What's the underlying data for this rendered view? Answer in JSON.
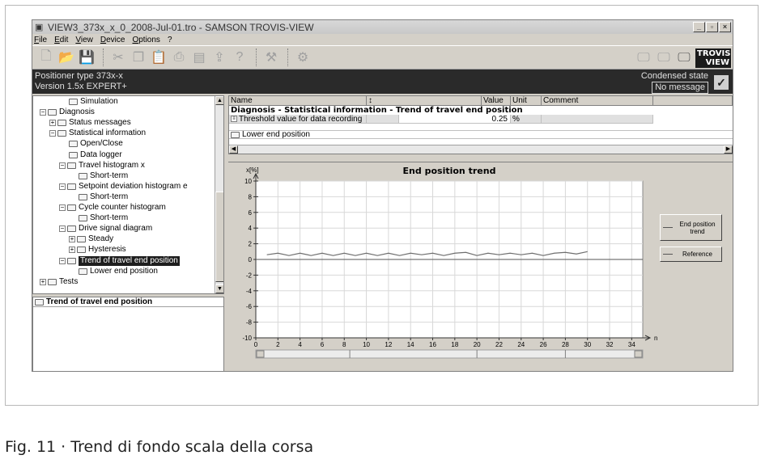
{
  "window": {
    "title": "VIEW3_373x_x_0_2008-Jul-01.tro - SAMSON TROVIS-VIEW",
    "controls": [
      "_",
      "▫",
      "×"
    ]
  },
  "menu": [
    "File",
    "Edit",
    "View",
    "Device",
    "Options",
    "?"
  ],
  "toolbar": {
    "left_icons": [
      "new-icon",
      "open-icon",
      "save-icon",
      "cut-icon",
      "copy-icon",
      "paste-icon",
      "print-icon",
      "edit-icon",
      "upload-icon",
      "help-icon",
      "tools-icon",
      "device-icon"
    ],
    "right_icons": [
      "monitor-offline-icon",
      "monitor-icon",
      "monitor-online-icon"
    ],
    "logo_line1": "TROVIS",
    "logo_line2": "VIEW"
  },
  "infobar": {
    "device_line1": "Positioner type 373x-x",
    "device_line2": "Version 1.5x EXPERT+",
    "condensed_label": "Condensed state",
    "condensed_value": "No message"
  },
  "tree": {
    "items": [
      {
        "label": "Simulation",
        "indent": 3,
        "expander": ""
      },
      {
        "label": "Diagnosis",
        "indent": 1,
        "expander": "−"
      },
      {
        "label": "Status messages",
        "indent": 2,
        "expander": "+"
      },
      {
        "label": "Statistical information",
        "indent": 2,
        "expander": "−"
      },
      {
        "label": "Open/Close",
        "indent": 3,
        "expander": ""
      },
      {
        "label": "Data logger",
        "indent": 3,
        "expander": ""
      },
      {
        "label": "Travel histogram x",
        "indent": 3,
        "expander": "−"
      },
      {
        "label": "Short-term",
        "indent": 4,
        "expander": ""
      },
      {
        "label": "Setpoint deviation histogram e",
        "indent": 3,
        "expander": "−"
      },
      {
        "label": "Short-term",
        "indent": 4,
        "expander": ""
      },
      {
        "label": "Cycle counter histogram",
        "indent": 3,
        "expander": "−"
      },
      {
        "label": "Short-term",
        "indent": 4,
        "expander": ""
      },
      {
        "label": "Drive signal diagram",
        "indent": 3,
        "expander": "−"
      },
      {
        "label": "Steady",
        "indent": 4,
        "expander": "+"
      },
      {
        "label": "Hysteresis",
        "indent": 4,
        "expander": "+"
      },
      {
        "label": "Trend of travel end position",
        "indent": 3,
        "expander": "−",
        "selected": true
      },
      {
        "label": "Lower end position",
        "indent": 4,
        "expander": ""
      },
      {
        "label": "Tests",
        "indent": 1,
        "expander": "+"
      }
    ]
  },
  "detail": {
    "title": "Trend of travel end position"
  },
  "grid": {
    "headers": [
      "Name",
      "↕",
      "Value",
      "Unit",
      "Comment"
    ],
    "group_title": "Diagnosis - Statistical information - Trend of travel end position",
    "rows": [
      {
        "name": "Threshold value for data recording",
        "value": "0.25",
        "unit": "%",
        "comment": ""
      }
    ],
    "sub_item": "Lower end position"
  },
  "chart_data": {
    "type": "line",
    "title": "End position trend",
    "ylabel": "x[%]",
    "xlabel": "n",
    "xlim": [
      0,
      35
    ],
    "ylim": [
      -10,
      10
    ],
    "x_ticks": [
      0,
      2,
      4,
      6,
      8,
      10,
      12,
      14,
      16,
      18,
      20,
      22,
      24,
      26,
      28,
      30,
      32,
      34
    ],
    "x_tick_labels": [
      "0",
      "2",
      "4",
      "6",
      "8",
      "10",
      "12",
      "14",
      "16",
      "18",
      "20",
      "22",
      "24",
      "26",
      "28",
      "30",
      "32",
      "34"
    ],
    "y_ticks": [
      10,
      8,
      6,
      4,
      2,
      0,
      -2,
      -4,
      -6,
      -8,
      -10
    ],
    "grid": true,
    "legend_position": "right",
    "series": [
      {
        "name": "End position trend",
        "color": "#6e6e6e",
        "x": [
          1,
          2,
          3,
          4,
          5,
          6,
          7,
          8,
          9,
          10,
          11,
          12,
          13,
          14,
          15,
          16,
          17,
          18,
          19,
          20,
          21,
          22,
          23,
          24,
          25,
          26,
          27,
          28,
          29,
          30
        ],
        "y": [
          0.6,
          0.8,
          0.5,
          0.8,
          0.5,
          0.8,
          0.5,
          0.8,
          0.5,
          0.8,
          0.5,
          0.8,
          0.5,
          0.8,
          0.6,
          0.8,
          0.5,
          0.8,
          0.9,
          0.5,
          0.8,
          0.6,
          0.8,
          0.6,
          0.8,
          0.5,
          0.8,
          0.9,
          0.7,
          1.0
        ]
      },
      {
        "name": "Reference",
        "color": "#555555",
        "x": [
          0,
          35
        ],
        "y": [
          0,
          0
        ]
      }
    ]
  },
  "caption": "Fig. 11 · Trend di fondo scala della corsa"
}
